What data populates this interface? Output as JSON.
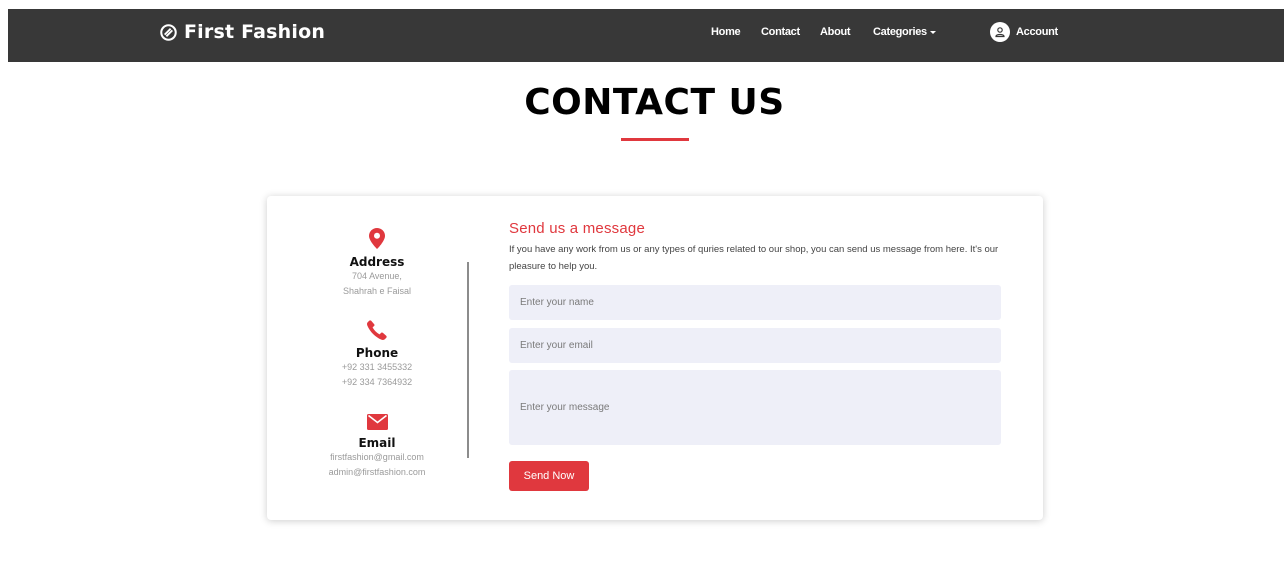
{
  "nav": {
    "brand": "First Fashion",
    "links": [
      {
        "label": "Home"
      },
      {
        "label": "Contact"
      },
      {
        "label": "About"
      },
      {
        "label": "Categories"
      }
    ],
    "account_label": "Account"
  },
  "page": {
    "title": "CONTACT US"
  },
  "contact_info": {
    "address": {
      "heading": "Address",
      "lines": [
        "704 Avenue,",
        "Shahrah e Faisal"
      ],
      "icon": "map-pin-icon"
    },
    "phone": {
      "heading": "Phone",
      "lines": [
        "+92 331 3455332",
        "+92 334 7364932"
      ],
      "icon": "phone-icon"
    },
    "email": {
      "heading": "Email",
      "lines": [
        "firstfashion@gmail.com",
        "admin@firstfashion.com"
      ],
      "icon": "envelope-icon"
    }
  },
  "form": {
    "title": "Send us a message",
    "description": "If you have any work from us or any types of quries related to our shop, you can send us message from here. It's our pleasure to help you.",
    "name_placeholder": "Enter your name",
    "email_placeholder": "Enter your email",
    "message_placeholder": "Enter your message",
    "submit_label": "Send Now"
  },
  "colors": {
    "accent": "#e0383e",
    "navbar_bg": "#383838",
    "field_bg": "#eeeff8"
  }
}
